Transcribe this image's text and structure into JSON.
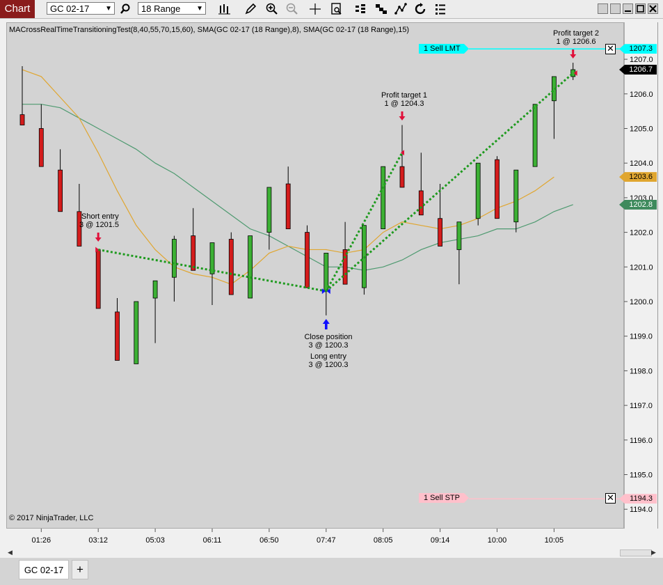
{
  "window": {
    "title": "Chart",
    "instrument": "GC 02-17",
    "bar_type": "18 Range"
  },
  "toolbar_icons": [
    "bar-style-icon",
    "draw-tool-icon",
    "zoom-in-icon",
    "zoom-out-icon",
    "crosshair-icon",
    "data-box-icon",
    "strategies-icon",
    "indicators-icon",
    "chart-trader-icon",
    "reload-icon",
    "properties-icon"
  ],
  "chart": {
    "indicator_label": "MACrossRealTimeTransitioningTest(8,40,55,70,15,60), SMA(GC 02-17 (18 Range),8), SMA(GC 02-17 (18 Range),15)",
    "copyright": "© 2017 NinjaTrader, LLC",
    "colors": {
      "background": "#d3d3d3",
      "up_bar": "#3cb034",
      "down_bar": "#d41c1c",
      "sma_fast": "#e0a630",
      "sma_slow": "#4e9a70",
      "trade_line": "#1e9a1e",
      "sell_lmt": "#00ffff",
      "sell_stp": "#ffc0cb",
      "marker_sell": "#e0103a",
      "marker_buy": "#1010ff"
    },
    "annotations": [
      {
        "title": "Short entry",
        "detail": "3 @ 1201.5"
      },
      {
        "title": "Close position",
        "detail": "3 @ 1200.3"
      },
      {
        "title": "Long entry",
        "detail": "3 @ 1200.3"
      },
      {
        "title": "Profit target 1",
        "detail": "1 @ 1204.3"
      },
      {
        "title": "Profit target 2",
        "detail": "1 @ 1206.6"
      }
    ],
    "orders": [
      {
        "label": "1  Sell LMT",
        "price": "1207.3"
      },
      {
        "label": "1  Sell STP",
        "price": "1194.3"
      }
    ],
    "price_markers": [
      {
        "value": "1207.3",
        "price": 1207.3,
        "bg": "#00ffff",
        "fg": "#000000"
      },
      {
        "value": "1206.7",
        "price": 1206.7,
        "bg": "#000000",
        "fg": "#ffffff"
      },
      {
        "value": "1203.6",
        "price": 1203.6,
        "bg": "#e0a630",
        "fg": "#000000"
      },
      {
        "value": "1202.8",
        "price": 1202.8,
        "bg": "#3e8a5c",
        "fg": "#ffffff"
      },
      {
        "value": "1194.3",
        "price": 1194.3,
        "bg": "#ffc0cb",
        "fg": "#000000"
      }
    ]
  },
  "chart_data": {
    "type": "candlestick",
    "y_ticks": [
      1194.0,
      1195.0,
      1196.0,
      1197.0,
      1198.0,
      1199.0,
      1200.0,
      1201.0,
      1202.0,
      1203.0,
      1204.0,
      1205.0,
      1206.0,
      1207.0
    ],
    "x_ticks": [
      {
        "label": "01:26",
        "bar": 1
      },
      {
        "label": "03:12",
        "bar": 4
      },
      {
        "label": "05:03",
        "bar": 7
      },
      {
        "label": "06:11",
        "bar": 10
      },
      {
        "label": "06:50",
        "bar": 13
      },
      {
        "label": "07:47",
        "bar": 16
      },
      {
        "label": "08:05",
        "bar": 19
      },
      {
        "label": "09:14",
        "bar": 22
      },
      {
        "label": "10:00",
        "bar": 25
      },
      {
        "label": "10:05",
        "bar": 28
      }
    ],
    "bars": [
      {
        "o": 1205.4,
        "h": 1206.8,
        "l": 1205.1,
        "c": 1205.1
      },
      {
        "o": 1205.0,
        "h": 1205.7,
        "l": 1203.9,
        "c": 1203.9
      },
      {
        "o": 1203.8,
        "h": 1204.4,
        "l": 1202.6,
        "c": 1202.6
      },
      {
        "o": 1202.6,
        "h": 1203.4,
        "l": 1201.6,
        "c": 1201.6
      },
      {
        "o": 1201.5,
        "h": 1201.5,
        "l": 1199.8,
        "c": 1199.8
      },
      {
        "o": 1199.7,
        "h": 1200.1,
        "l": 1198.3,
        "c": 1198.3
      },
      {
        "o": 1198.2,
        "h": 1200.0,
        "l": 1198.2,
        "c": 1200.0
      },
      {
        "o": 1200.1,
        "h": 1200.6,
        "l": 1198.8,
        "c": 1200.6
      },
      {
        "o": 1200.7,
        "h": 1201.9,
        "l": 1200.0,
        "c": 1201.8
      },
      {
        "o": 1201.9,
        "h": 1202.7,
        "l": 1200.9,
        "c": 1200.9
      },
      {
        "o": 1200.8,
        "h": 1201.7,
        "l": 1199.9,
        "c": 1201.7
      },
      {
        "o": 1201.8,
        "h": 1202.0,
        "l": 1200.2,
        "c": 1200.2
      },
      {
        "o": 1200.1,
        "h": 1201.9,
        "l": 1200.1,
        "c": 1201.9
      },
      {
        "o": 1202.0,
        "h": 1203.3,
        "l": 1201.5,
        "c": 1203.3
      },
      {
        "o": 1203.4,
        "h": 1203.9,
        "l": 1202.1,
        "c": 1202.1
      },
      {
        "o": 1202.0,
        "h": 1202.2,
        "l": 1200.4,
        "c": 1200.4
      },
      {
        "o": 1200.3,
        "h": 1201.4,
        "l": 1199.6,
        "c": 1201.4
      },
      {
        "o": 1201.5,
        "h": 1202.3,
        "l": 1200.5,
        "c": 1200.5
      },
      {
        "o": 1200.4,
        "h": 1202.2,
        "l": 1200.2,
        "c": 1202.2
      },
      {
        "o": 1202.1,
        "h": 1203.9,
        "l": 1202.1,
        "c": 1203.9
      },
      {
        "o": 1203.9,
        "h": 1205.1,
        "l": 1203.3,
        "c": 1203.3
      },
      {
        "o": 1203.2,
        "h": 1204.3,
        "l": 1202.5,
        "c": 1202.5
      },
      {
        "o": 1202.4,
        "h": 1203.4,
        "l": 1201.6,
        "c": 1201.6
      },
      {
        "o": 1201.5,
        "h": 1202.3,
        "l": 1200.5,
        "c": 1202.3
      },
      {
        "o": 1202.4,
        "h": 1204.0,
        "l": 1202.2,
        "c": 1204.0
      },
      {
        "o": 1204.1,
        "h": 1204.2,
        "l": 1202.4,
        "c": 1202.4
      },
      {
        "o": 1202.3,
        "h": 1203.8,
        "l": 1202.0,
        "c": 1203.8
      },
      {
        "o": 1203.9,
        "h": 1205.7,
        "l": 1203.9,
        "c": 1205.7
      },
      {
        "o": 1205.8,
        "h": 1206.5,
        "l": 1204.7,
        "c": 1206.5
      },
      {
        "o": 1206.5,
        "h": 1206.9,
        "l": 1206.4,
        "c": 1206.7
      }
    ],
    "sma_fast": [
      1206.7,
      1206.5,
      1205.9,
      1205.3,
      1204.3,
      1203.2,
      1202.2,
      1201.5,
      1201.0,
      1200.8,
      1200.7,
      1200.5,
      1200.9,
      1201.4,
      1201.6,
      1201.5,
      1201.5,
      1201.4,
      1201.5,
      1202.0,
      1202.3,
      1202.2,
      1202.1,
      1202.2,
      1202.4,
      1202.7,
      1202.9,
      1203.2,
      1203.6
    ],
    "sma_slow": [
      1205.7,
      1205.7,
      1205.6,
      1205.3,
      1205.0,
      1204.7,
      1204.4,
      1204.0,
      1203.7,
      1203.3,
      1202.9,
      1202.5,
      1202.1,
      1201.9,
      1201.6,
      1201.3,
      1201.0,
      1201.0,
      1200.9,
      1201.0,
      1201.2,
      1201.5,
      1201.7,
      1201.8,
      1201.9,
      1202.1,
      1202.1,
      1202.3,
      1202.6,
      1202.8
    ],
    "trade_lines": [
      {
        "from_bar": 4,
        "from_price": 1201.5,
        "to_bar": 16,
        "to_price": 1200.3
      },
      {
        "from_bar": 16,
        "from_price": 1200.3,
        "to_bar": 20,
        "to_price": 1204.3
      },
      {
        "from_bar": 16,
        "from_price": 1200.3,
        "to_bar": 29,
        "to_price": 1206.6
      }
    ]
  }
}
